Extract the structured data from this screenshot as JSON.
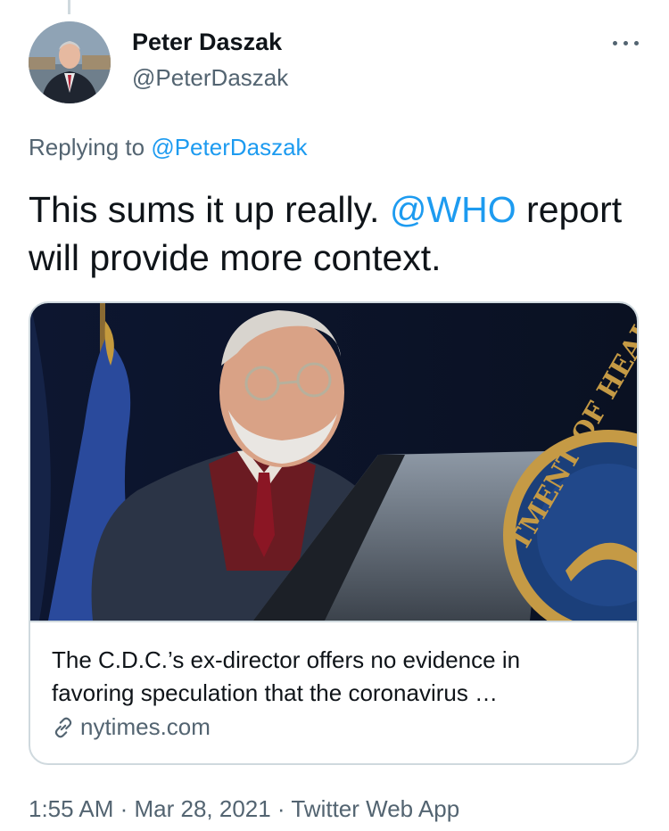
{
  "tweet": {
    "author_name": "Peter Daszak",
    "author_handle": "@PeterDaszak",
    "replying_prefix": "Replying to",
    "replying_handle": "@PeterDaszak",
    "text_before": "This sums it up really.",
    "mention": "@WHO",
    "text_after": "report will provide more context.",
    "timestamp": "1:55 AM · Mar 28, 2021 · Twitter Web App"
  },
  "card": {
    "description_line1": "The C.D.C.’s ex-director offers no evidence in",
    "description_line2": "favoring speculation that the coronavirus …",
    "domain": "nytimes.com",
    "seal_text": "TMENT OF HEAL"
  },
  "icons": {
    "more": "more-horizontal-icon",
    "link": "link-icon"
  },
  "colors": {
    "link_blue": "#1d9bf0",
    "secondary_text": "#536471",
    "border": "#cfd9de"
  }
}
